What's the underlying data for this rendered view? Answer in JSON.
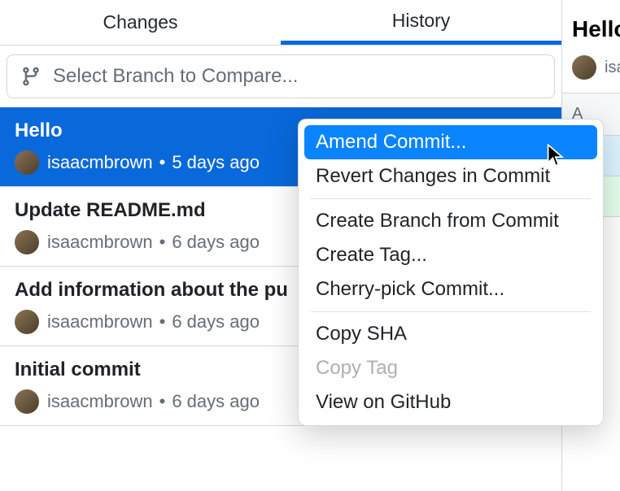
{
  "tabs": {
    "changes": "Changes",
    "history": "History"
  },
  "branchCompare": {
    "placeholder": "Select Branch to Compare..."
  },
  "commits": [
    {
      "title": "Hello",
      "author": "isaacmbrown",
      "time": "5 days ago",
      "selected": true
    },
    {
      "title": "Update README.md",
      "author": "isaacmbrown",
      "time": "6 days ago",
      "selected": false
    },
    {
      "title": "Add information about the pu",
      "author": "isaacmbrown",
      "time": "6 days ago",
      "selected": false
    },
    {
      "title": "Initial commit",
      "author": "isaacmbrown",
      "time": "6 days ago",
      "selected": false
    }
  ],
  "rightPanel": {
    "title": "Hello",
    "author": "isaacmbrown",
    "fileBadge": "A",
    "diffContext": "@",
    "diffAdd": "+"
  },
  "contextMenu": {
    "items": [
      {
        "label": "Amend Commit...",
        "state": "highlighted"
      },
      {
        "label": "Revert Changes in Commit",
        "state": "normal"
      },
      {
        "type": "separator"
      },
      {
        "label": "Create Branch from Commit",
        "state": "normal"
      },
      {
        "label": "Create Tag...",
        "state": "normal"
      },
      {
        "label": "Cherry-pick Commit...",
        "state": "normal"
      },
      {
        "type": "separator"
      },
      {
        "label": "Copy SHA",
        "state": "normal"
      },
      {
        "label": "Copy Tag",
        "state": "disabled"
      },
      {
        "label": "View on GitHub",
        "state": "normal"
      }
    ]
  }
}
